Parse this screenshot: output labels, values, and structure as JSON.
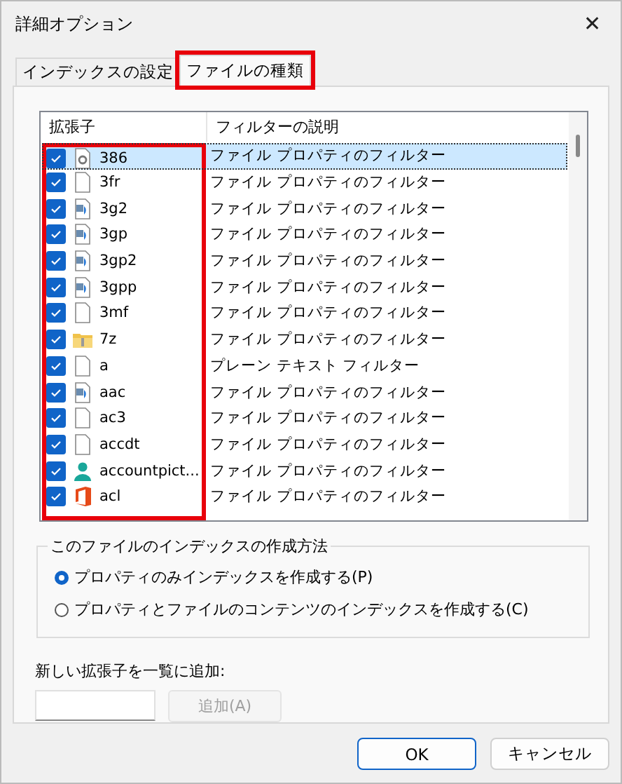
{
  "window": {
    "title": "詳細オプション",
    "close": "✕"
  },
  "tabs": [
    {
      "label": "インデックスの設定",
      "selected": false,
      "highlighted": false
    },
    {
      "label": "ファイルの種類",
      "selected": true,
      "highlighted": true
    }
  ],
  "table": {
    "columns": [
      "拡張子",
      "フィルターの説明"
    ],
    "extensions_highlighted": true,
    "rows": [
      {
        "kind": "gear",
        "ext": "386",
        "filter": "ファイル プロパティのフィルター",
        "checked": true,
        "selected": true
      },
      {
        "kind": "blank",
        "ext": "3fr",
        "filter": "ファイル プロパティのフィルター",
        "checked": true,
        "selected": false
      },
      {
        "kind": "media",
        "ext": "3g2",
        "filter": "ファイル プロパティのフィルター",
        "checked": true,
        "selected": false
      },
      {
        "kind": "media",
        "ext": "3gp",
        "filter": "ファイル プロパティのフィルター",
        "checked": true,
        "selected": false
      },
      {
        "kind": "media",
        "ext": "3gp2",
        "filter": "ファイル プロパティのフィルター",
        "checked": true,
        "selected": false
      },
      {
        "kind": "media",
        "ext": "3gpp",
        "filter": "ファイル プロパティのフィルター",
        "checked": true,
        "selected": false
      },
      {
        "kind": "blank",
        "ext": "3mf",
        "filter": "ファイル プロパティのフィルター",
        "checked": true,
        "selected": false
      },
      {
        "kind": "zip",
        "ext": "7z",
        "filter": "ファイル プロパティのフィルター",
        "checked": true,
        "selected": false
      },
      {
        "kind": "blank",
        "ext": "a",
        "filter": "プレーン テキスト フィルター",
        "checked": true,
        "selected": false
      },
      {
        "kind": "media",
        "ext": "aac",
        "filter": "ファイル プロパティのフィルター",
        "checked": true,
        "selected": false
      },
      {
        "kind": "blank",
        "ext": "ac3",
        "filter": "ファイル プロパティのフィルター",
        "checked": true,
        "selected": false
      },
      {
        "kind": "blank",
        "ext": "accdt",
        "filter": "ファイル プロパティのフィルター",
        "checked": true,
        "selected": false
      },
      {
        "kind": "person",
        "ext": "accountpict...",
        "filter": "ファイル プロパティのフィルター",
        "checked": true,
        "selected": false
      },
      {
        "kind": "office",
        "ext": "acl",
        "filter": "ファイル プロパティのフィルター",
        "checked": true,
        "selected": false
      }
    ]
  },
  "index_method": {
    "title": "このファイルのインデックスの作成方法",
    "options": [
      {
        "label": "プロパティのみインデックスを作成する(P)",
        "selected": true
      },
      {
        "label": "プロパティとファイルのコンテンツのインデックスを作成する(C)",
        "selected": false
      }
    ]
  },
  "add_extension": {
    "label": "新しい拡張子を一覧に追加:",
    "button": "追加(A)",
    "button_disabled": true
  },
  "buttons": [
    "OK",
    "キャンセル"
  ]
}
